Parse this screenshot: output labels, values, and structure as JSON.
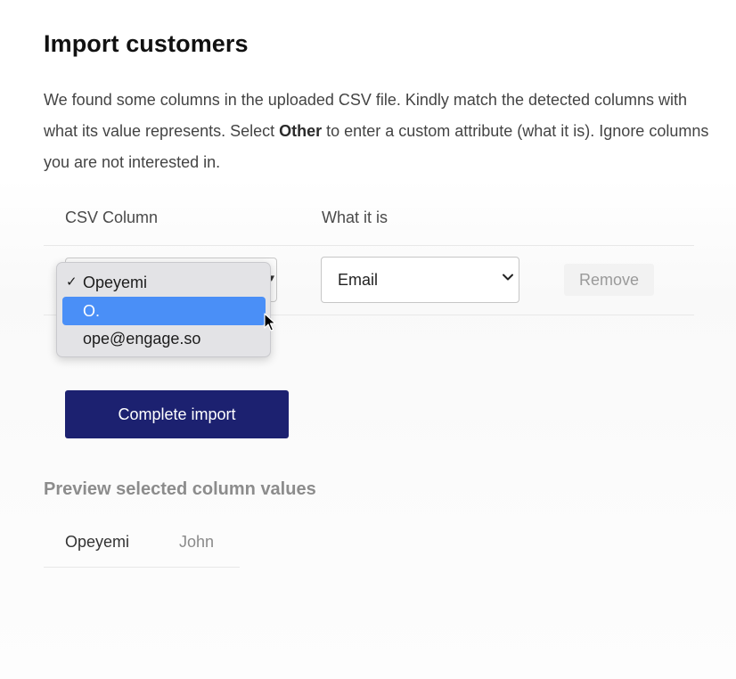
{
  "page": {
    "title": "Import customers",
    "description": {
      "part1": "We found some columns in the uploaded CSV file. Kindly match the detected columns with what its value represents. Select ",
      "bold": "Other",
      "part2": " to enter a custom attribute (what it is). Ignore columns you are not interested in."
    }
  },
  "table": {
    "headers": [
      "CSV Column",
      "What it is"
    ],
    "row": {
      "what_it_is_value": "Email",
      "remove_label": "Remove"
    }
  },
  "dropdown": {
    "options": [
      {
        "label": "Opeyemi",
        "checked": true,
        "highlighted": false
      },
      {
        "label": "O.",
        "checked": false,
        "highlighted": true
      },
      {
        "label": "ope@engage.so",
        "checked": false,
        "highlighted": false
      }
    ],
    "check_glyph": "✓"
  },
  "actions": {
    "complete_label": "Complete import"
  },
  "preview": {
    "title": "Preview selected column values",
    "values": [
      "Opeyemi",
      "John"
    ]
  },
  "colors": {
    "primary_button": "#1c2170",
    "highlight": "#4a8ff7"
  },
  "icons": {
    "select_chevron": "chevron-down-icon",
    "check": "check-icon",
    "cursor": "mouse-cursor-icon"
  }
}
